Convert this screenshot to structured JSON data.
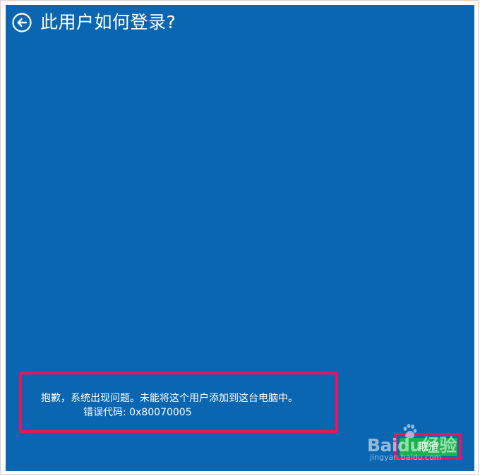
{
  "header": {
    "title": "此用户如何登录?",
    "back_icon": "back-arrow-circle-icon"
  },
  "error": {
    "message": "抱歉，系统出现问题。未能将这个用户添加到这台电脑中。",
    "code": "错误代码: 0x80070005"
  },
  "footer": {
    "cancel_label": "取消"
  },
  "watermark": {
    "logo": "Baidu经验",
    "url": "jingyan.baidu.com"
  },
  "colors": {
    "background": "#0a66b1",
    "highlight": "#e6155d",
    "button": "#19b24b"
  }
}
